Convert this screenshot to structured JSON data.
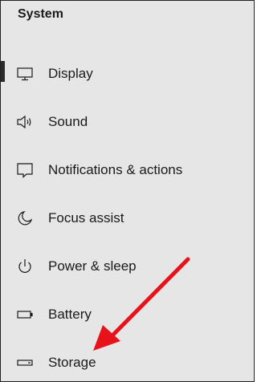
{
  "header": {
    "title": "System"
  },
  "nav": {
    "selected": "Display",
    "items": [
      {
        "label": "Display",
        "icon": "display-icon"
      },
      {
        "label": "Sound",
        "icon": "speaker-icon"
      },
      {
        "label": "Notifications & actions",
        "icon": "notification-icon"
      },
      {
        "label": "Focus assist",
        "icon": "moon-icon"
      },
      {
        "label": "Power & sleep",
        "icon": "power-icon"
      },
      {
        "label": "Battery",
        "icon": "battery-icon"
      },
      {
        "label": "Storage",
        "icon": "storage-icon"
      }
    ]
  },
  "annotation": {
    "type": "arrow",
    "color": "#e8121a",
    "target": "Storage"
  },
  "colors": {
    "panel": "#e6e6e6",
    "text": "#1a1a1a",
    "selection_bar": "#2b2b2b"
  }
}
